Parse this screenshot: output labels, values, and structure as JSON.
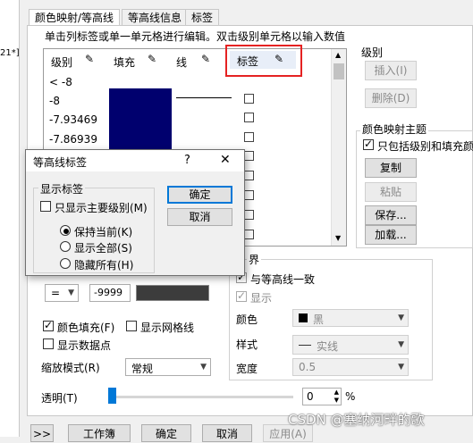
{
  "left_sliver": {
    "text": "21*]"
  },
  "tabs": [
    "颜色映射/等高线",
    "等高线信息",
    "标签"
  ],
  "instruction": "单击列标签或单一单元格进行编辑。双击级别单元格以输入数值",
  "table": {
    "headers": {
      "level": "级别",
      "fill": "填充",
      "line": "线",
      "label": "标签"
    },
    "rows": [
      "< -8",
      "-8",
      "-7.93469",
      "-7.86939"
    ],
    "fill_color": "#00006e"
  },
  "level_group": {
    "title": "级别",
    "insert": "插入(I)",
    "delete": "删除(D)"
  },
  "colormap_theme": {
    "title": "颜色映射主题",
    "only_levels": "只包括级别和填充颜",
    "copy": "复制",
    "paste": "粘贴",
    "save": "保存...",
    "load": "加载..."
  },
  "boundary": {
    "title": "界",
    "same_as_contour": "与等高线一致",
    "show": "显示",
    "color_label": "颜色",
    "color_value": "黑",
    "style_label": "样式",
    "style_value": "实线",
    "width_label": "宽度",
    "width_value": "0.5"
  },
  "condition": {
    "op": "=",
    "value": "-9999"
  },
  "options": {
    "color_fill": "颜色填充(F)",
    "show_grid": "显示网格线",
    "show_points": "显示数据点"
  },
  "scale_mode": {
    "label": "缩放模式(R)",
    "value": "常规"
  },
  "transparency": {
    "label": "透明(T)",
    "value": "0",
    "unit": "%"
  },
  "bottom_buttons": {
    "expand": ">>",
    "workbook": "工作簿",
    "ok": "确定",
    "cancel": "取消",
    "apply": "应用(A)"
  },
  "watermark": "CSDN @塞纳河畔的歌",
  "dialog": {
    "title": "等高线标签",
    "help": "?",
    "close": "✕",
    "group_title": "显示标签",
    "only_major": "只显示主要级别(M)",
    "keep": "保持当前(K)",
    "show_all": "显示全部(S)",
    "hide_all": "隐藏所有(H)",
    "ok": "确定",
    "cancel": "取消"
  }
}
